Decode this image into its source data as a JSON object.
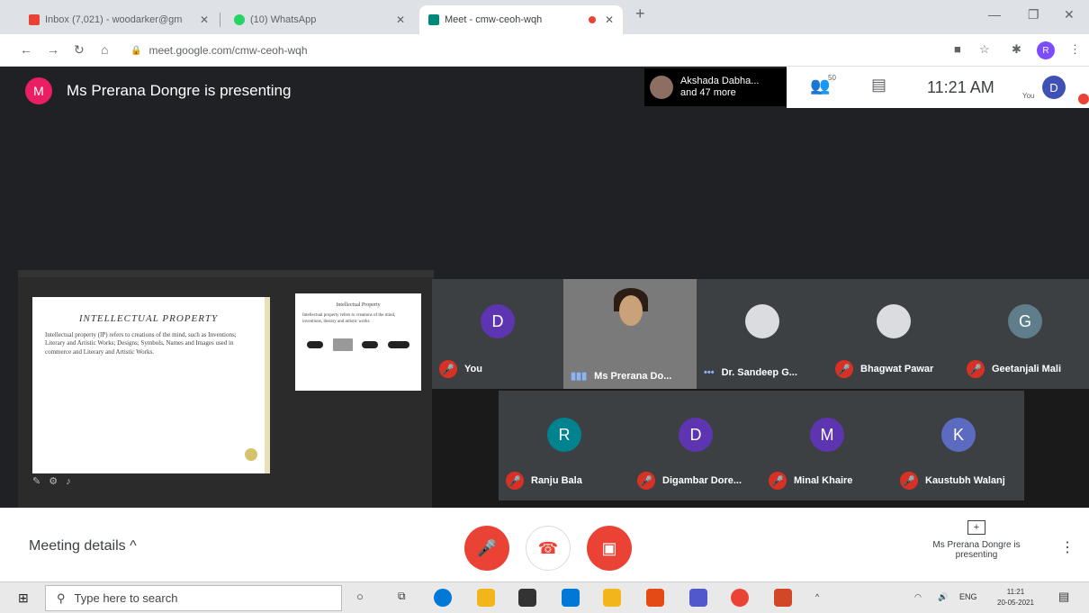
{
  "browser": {
    "tabs": [
      {
        "label": "Inbox (7,021) - woodarker@gm",
        "color": "#ea4335"
      },
      {
        "label": "(10) WhatsApp",
        "color": "#25d366"
      },
      {
        "label": "Meet - cmw-ceoh-wqh",
        "color": "#00897b"
      }
    ],
    "new_tab": "+",
    "url": "meet.google.com/cmw-ceoh-wqh",
    "window_controls": [
      "—",
      "❐",
      "✕"
    ],
    "profile_initial": "R"
  },
  "meet": {
    "presenter_initial": "M",
    "presenting_text": "Ms Prerana Dongre is presenting",
    "pill_line1": "Akshada Dabha...",
    "pill_line2": "and 47 more",
    "people_count": "50",
    "clock": "11:21 AM",
    "you_label": "You",
    "you_initial": "D",
    "slide1": {
      "title": "INTELLECTUAL PROPERTY",
      "body": "Intellectual property (IP) refers to creations of the mind, such as Inventions; Literary and Artistic Works; Designs; Symbols, Names and Images used in commerce and Literary and Artistic Works."
    },
    "slide2": {
      "title": "Intellectual Property",
      "body": "Intellectual property refers to creations of the mind, inventions, literary and artistic works"
    },
    "participants_row1": [
      {
        "initial": "D",
        "name": "You",
        "color": "#5e35b1",
        "mic": "off"
      },
      {
        "initial": "",
        "name": "Ms Prerana Do...",
        "color": "",
        "mic": "speaking"
      },
      {
        "initial": "",
        "name": "Dr. Sandeep G...",
        "color": "",
        "mic": "more"
      },
      {
        "initial": "",
        "name": "Bhagwat Pawar",
        "color": "",
        "mic": "off"
      },
      {
        "initial": "G",
        "name": "Geetanjali Mali",
        "color": "#607d8b",
        "mic": "off"
      }
    ],
    "participants_row2": [
      {
        "initial": "R",
        "name": "Ranju Bala",
        "color": "#00838f",
        "mic": "off"
      },
      {
        "initial": "D",
        "name": "Digambar Dore...",
        "color": "#5e35b1",
        "mic": "off"
      },
      {
        "initial": "M",
        "name": "Minal Khaire",
        "color": "#5e35b1",
        "mic": "off"
      },
      {
        "initial": "K",
        "name": "Kaustubh Walanj",
        "color": "#5c6bc0",
        "mic": "off"
      }
    ],
    "meeting_details": "Meeting details ^",
    "present_status": "Ms Prerana Dongre is presenting"
  },
  "taskbar": {
    "search_placeholder": "Type here to search",
    "lang": "ENG",
    "time": "11:21",
    "date": "20-05-2021"
  }
}
